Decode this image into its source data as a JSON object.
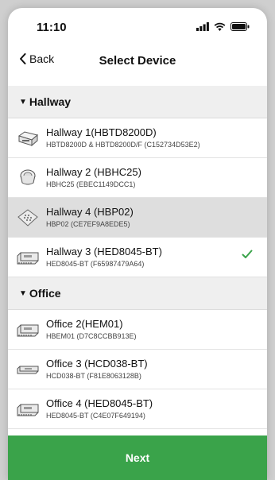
{
  "status_bar": {
    "time": "11:10"
  },
  "nav": {
    "back_label": "Back",
    "title": "Select Device"
  },
  "sections": [
    {
      "header": "Hallway",
      "items": [
        {
          "title": "Hallway 1(HBTD8200D)",
          "subtitle": "HBTD8200D & HBTD8200D/F (C152734D53E2)",
          "icon": "thermostat-box-icon",
          "selected": false,
          "highlighted": false
        },
        {
          "title": "Hallway 2 (HBHC25)",
          "subtitle": "HBHC25 (EBEC1149DCC1)",
          "icon": "round-dial-icon",
          "selected": false,
          "highlighted": false
        },
        {
          "title": "Hallway 4 (HBP02)",
          "subtitle": "HBP02 (CE7EF9A8EDE5)",
          "icon": "keypad-plate-icon",
          "selected": false,
          "highlighted": true
        },
        {
          "title": "Hallway 3 (HED8045-BT)",
          "subtitle": "HED8045-BT (F65987479A64)",
          "icon": "din-module-icon",
          "selected": true,
          "highlighted": false
        }
      ]
    },
    {
      "header": "Office",
      "items": [
        {
          "title": "Office 2(HEM01)",
          "subtitle": "HBEM01 (D7C8CCBB913E)",
          "icon": "din-module-icon",
          "selected": false,
          "highlighted": false
        },
        {
          "title": "Office 3 (HCD038-BT)",
          "subtitle": "HCD038-BT (F81E8063128B)",
          "icon": "slim-module-icon",
          "selected": false,
          "highlighted": false
        },
        {
          "title": "Office 4 (HED8045-BT)",
          "subtitle": "HED8045-BT (C4E07F649194)",
          "icon": "din-module-icon",
          "selected": false,
          "highlighted": false
        }
      ]
    }
  ],
  "next_button": {
    "label": "Next"
  },
  "colors": {
    "accent_green": "#3aa34a",
    "section_bg": "#efefef",
    "highlight_bg": "#dedede"
  }
}
